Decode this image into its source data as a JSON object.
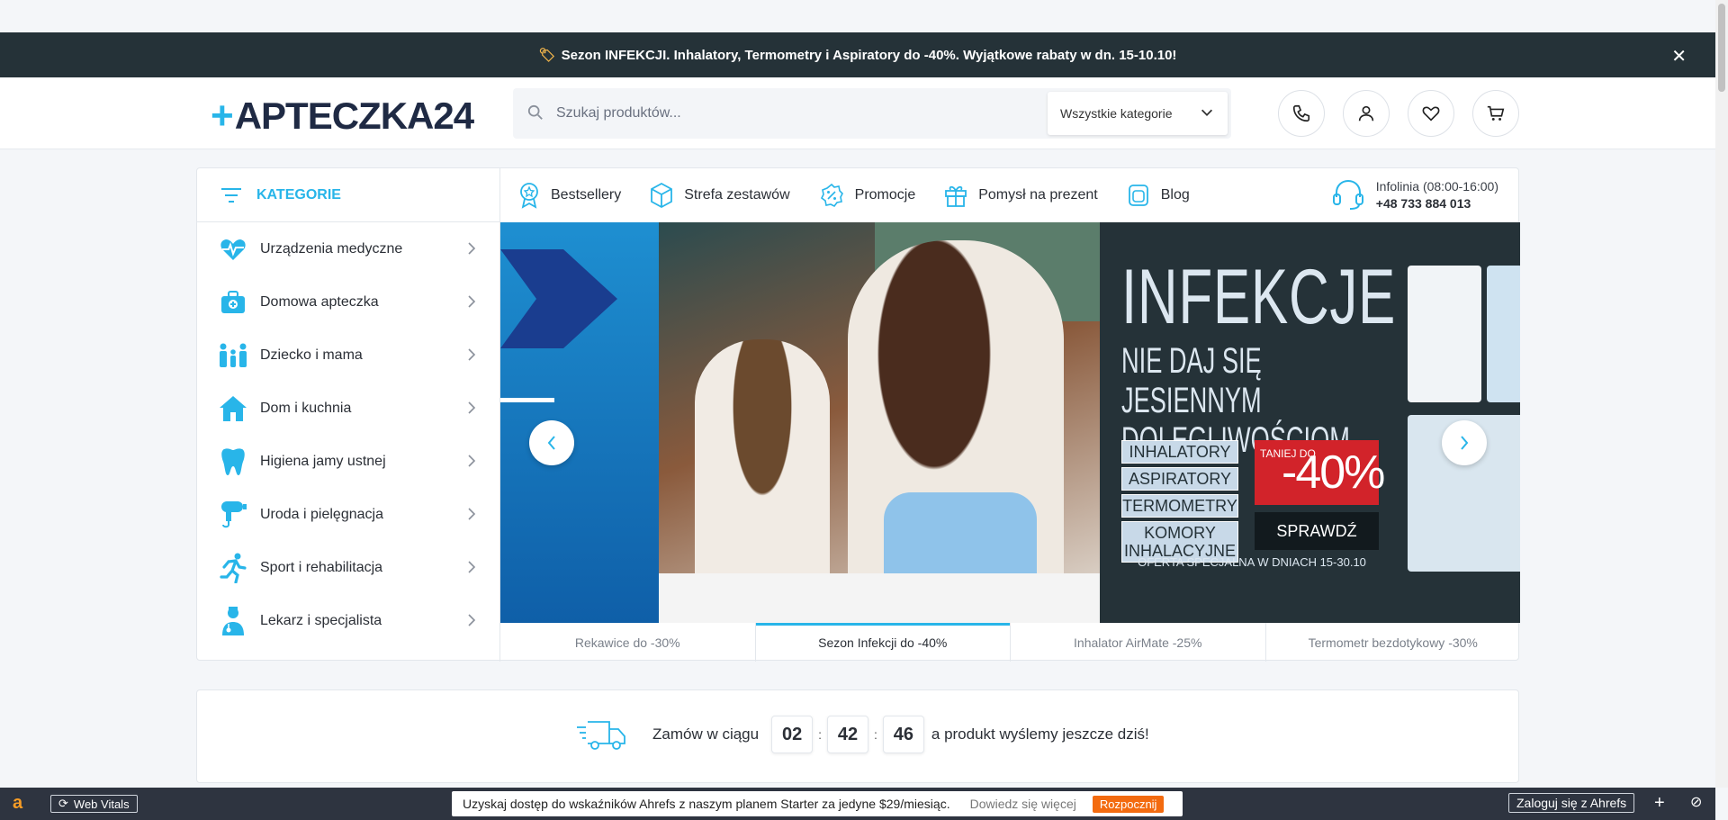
{
  "announcement": {
    "icon": "tag-icon",
    "text": "Sezon INFEKCJI. Inhalatory, Termometry i Aspiratory do -40%. Wyjątkowe rabaty w dn. 15-10.10!",
    "close": "✕"
  },
  "header": {
    "logo": "APTECZKA24",
    "logo_mark": "+",
    "search_placeholder": "Szukaj produktów...",
    "category_select": "Wszystkie kategorie"
  },
  "sidebar": {
    "title": "KATEGORIE",
    "items": [
      {
        "label": "Urządzenia medyczne",
        "icon": "heart-pulse-icon"
      },
      {
        "label": "Domowa apteczka",
        "icon": "first-aid-kit-icon"
      },
      {
        "label": "Dziecko i mama",
        "icon": "family-icon"
      },
      {
        "label": "Dom i kuchnia",
        "icon": "house-icon"
      },
      {
        "label": "Higiena jamy ustnej",
        "icon": "tooth-icon"
      },
      {
        "label": "Uroda i pielęgnacja",
        "icon": "hair-dryer-icon"
      },
      {
        "label": "Sport i rehabilitacja",
        "icon": "runner-icon"
      },
      {
        "label": "Lekarz i specjalista",
        "icon": "doctor-icon"
      }
    ]
  },
  "nav": {
    "items": [
      {
        "label": "Bestsellery",
        "icon": "award-icon"
      },
      {
        "label": "Strefa zestawów",
        "icon": "box-icon"
      },
      {
        "label": "Promocje",
        "icon": "discount-icon"
      },
      {
        "label": "Pomysł na prezent",
        "icon": "gift-icon"
      },
      {
        "label": "Blog",
        "icon": "blog-icon"
      }
    ],
    "hotline_label": "Infolinia (08:00-16:00)",
    "hotline_number": "+48 733 884 013"
  },
  "banner": {
    "title": "INFEKCJE",
    "subtitle1": "NIE DAJ SIĘ JESIENNYM",
    "subtitle2": "DOLEGLIWOŚCIOM",
    "tags": [
      "INHALATORY",
      "ASPIRATORY",
      "TERMOMETRY",
      "KOMORY INHALACYJNE"
    ],
    "discount_small": "TANIEJ DO",
    "discount_big": "-40%",
    "cta": "SPRAWDŹ",
    "offer": "OFERTA SPECJALNA W DNIACH 15-30.10"
  },
  "slider_tabs": [
    {
      "label": "Rekawice do -30%",
      "active": false
    },
    {
      "label": "Sezon Infekcji do -40%",
      "active": true
    },
    {
      "label": "Inhalator AirMate -25%",
      "active": false
    },
    {
      "label": "Termometr bezdotykowy -30%",
      "active": false
    }
  ],
  "shipping": {
    "prefix": "Zamów w ciągu",
    "hours": "02",
    "minutes": "42",
    "seconds": "46",
    "suffix": "a produkt wyślemy jeszcze dziś!"
  },
  "ahrefs": {
    "logo": "a",
    "web_vitals": "Web Vitals",
    "promo_text": "Uzyskaj dostęp do wskaźników Ahrefs z naszym planem Starter za jedyne $29/miesiąc.",
    "learn_more": "Dowiedz się więcej",
    "start": "Rozpocznij",
    "login": "Zaloguj się z Ahrefs"
  },
  "colors": {
    "accent": "#28b5e9",
    "dark": "#253238",
    "red": "#d2232a"
  }
}
